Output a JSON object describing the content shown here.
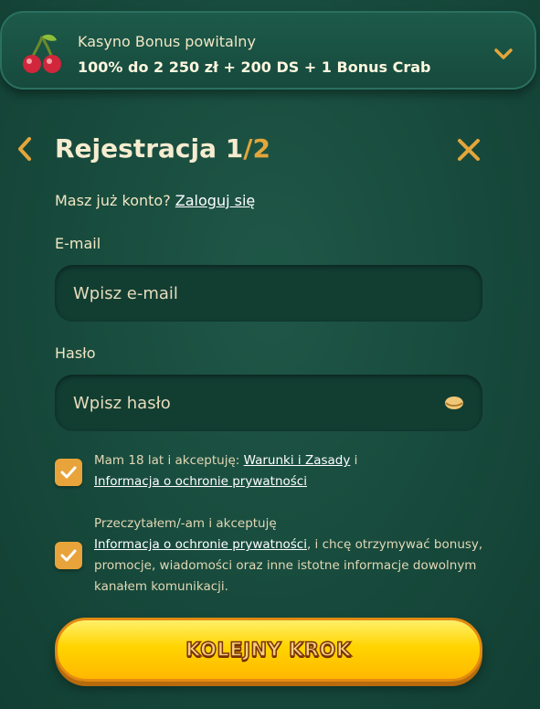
{
  "bonus": {
    "title": "Kasyno Bonus powitalny",
    "description": "100% do 2 250 zł + 200 DS + 1 Bonus Crab",
    "icon": "cherry-icon"
  },
  "header": {
    "title_prefix": "Rejestracja ",
    "step_current": "1",
    "step_total": "/2"
  },
  "login": {
    "prompt": "Masz już konto?",
    "link": "Zaloguj się"
  },
  "form": {
    "email_label": "E-mail",
    "email_placeholder": "Wpisz e-mail",
    "password_label": "Hasło",
    "password_placeholder": "Wpisz hasło"
  },
  "consents": {
    "age": {
      "checked": true,
      "text_before": "Mam 18 lat i akceptuję: ",
      "terms_link": "Warunki i Zasady",
      "text_middle": " i",
      "privacy_link": "Informacja o ochronie prywatności"
    },
    "marketing": {
      "checked": true,
      "line1": "Przeczytałem/-am i akceptuję",
      "privacy_link": "Informacja o ochronie prywatności",
      "text_after": ", i chcę otrzymywać bonusy,",
      "line3": "promocje, wiadomości oraz inne istotne informacje dowolnym",
      "line4": "kanałem komunikacji."
    }
  },
  "cta": {
    "label": "KOLEJNY KROK"
  },
  "colors": {
    "accent": "#e8a43a",
    "background": "#174a3c",
    "cta": "#ffd400"
  }
}
